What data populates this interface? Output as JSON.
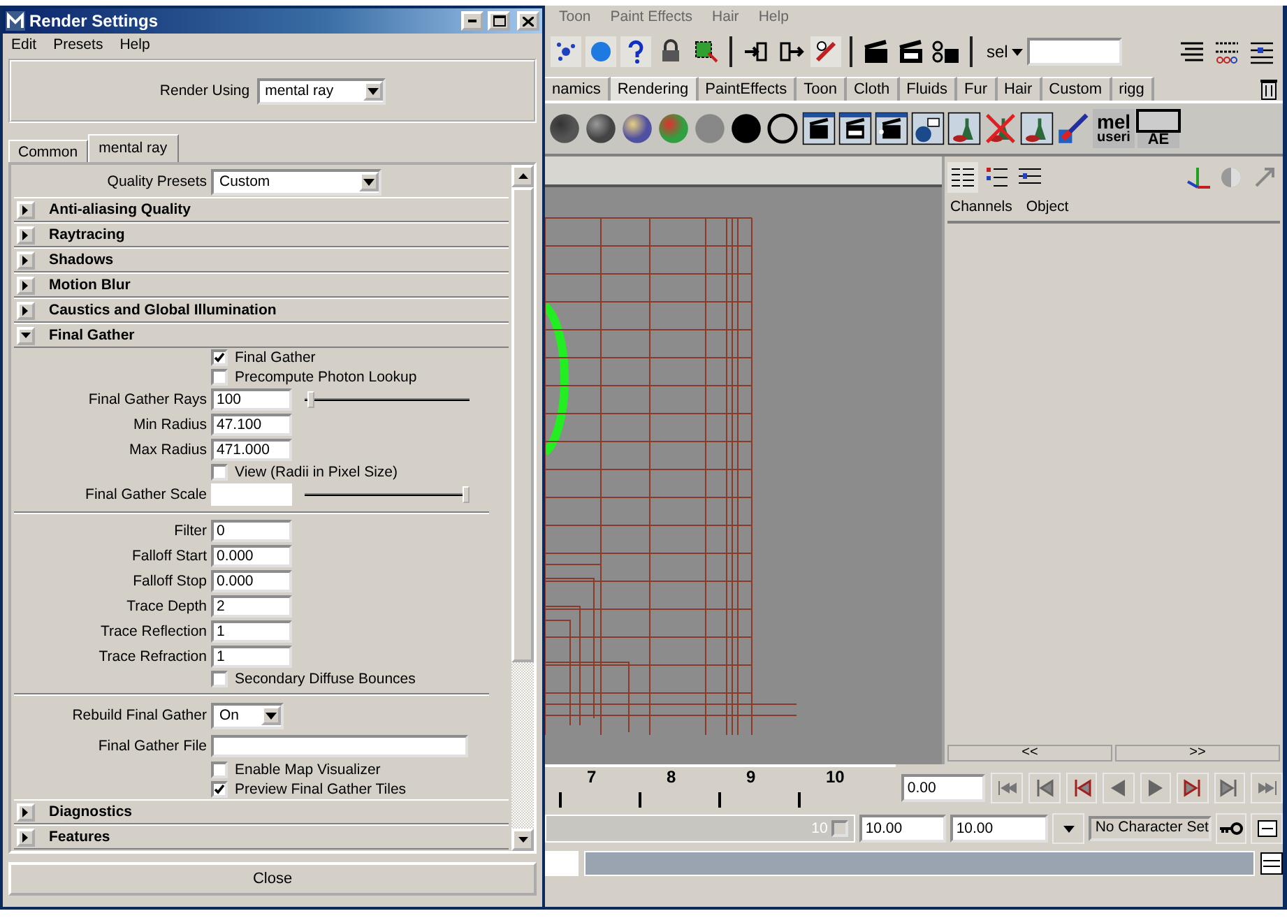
{
  "dialog": {
    "title": "Render Settings",
    "menu": [
      "Edit",
      "Presets",
      "Help"
    ],
    "render_using": {
      "label": "Render Using",
      "value": "mental ray"
    },
    "tabs": [
      {
        "label": "Common",
        "selected": false
      },
      {
        "label": "mental ray",
        "selected": true
      }
    ],
    "quality_presets": {
      "label": "Quality Presets",
      "value": "Custom"
    },
    "sections": [
      {
        "title": "Anti-aliasing Quality",
        "expanded": false
      },
      {
        "title": "Raytracing",
        "expanded": false
      },
      {
        "title": "Shadows",
        "expanded": false
      },
      {
        "title": "Motion Blur",
        "expanded": false
      },
      {
        "title": "Caustics and Global Illumination",
        "expanded": false
      },
      {
        "title": "Final Gather",
        "expanded": true,
        "rows": [
          {
            "kind": "checkbox",
            "label": "Final Gather",
            "checked": true
          },
          {
            "kind": "checkbox",
            "label": "Precompute Photon Lookup",
            "checked": false
          },
          {
            "kind": "field",
            "label": "Final Gather Rays",
            "value": "100",
            "level": 0.02
          },
          {
            "kind": "field",
            "label": "Min Radius",
            "value": "47.100"
          },
          {
            "kind": "field",
            "label": "Max Radius",
            "value": "471.000"
          },
          {
            "kind": "checkbox",
            "label": "View (Radii in Pixel Size)",
            "checked": false
          },
          {
            "kind": "field",
            "label": "Final Gather Scale",
            "level": 1
          },
          {
            "kind": "divider"
          },
          {
            "kind": "field",
            "label": "Filter",
            "value": "0"
          },
          {
            "kind": "field",
            "label": "Falloff Start",
            "value": "0.000"
          },
          {
            "kind": "field",
            "label": "Falloff Stop",
            "value": "0.000"
          },
          {
            "kind": "field",
            "label": "Trace Depth",
            "value": "2"
          },
          {
            "kind": "field",
            "label": "Trace Reflection",
            "value": "1"
          },
          {
            "kind": "field",
            "label": "Trace Refraction",
            "value": "1"
          },
          {
            "kind": "checkbox",
            "label": "Secondary Diffuse Bounces",
            "checked": false
          },
          {
            "kind": "divider"
          },
          {
            "kind": "dropdown",
            "label": "Rebuild Final Gather",
            "value": "On"
          },
          {
            "kind": "file",
            "label": "Final Gather File"
          },
          {
            "kind": "checkbox",
            "label": "Enable Map Visualizer",
            "checked": false
          },
          {
            "kind": "checkbox",
            "label": "Preview Final Gather Tiles",
            "checked": true
          }
        ]
      },
      {
        "title": "Diagnostics",
        "expanded": false
      },
      {
        "title": "Features",
        "expanded": false
      }
    ],
    "close_button": "Close"
  },
  "main": {
    "menu": [
      "Toon",
      "Paint Effects",
      "Hair",
      "Help"
    ],
    "selection_label": "sel",
    "shelf_tabs": [
      {
        "label": "namics",
        "selected": false
      },
      {
        "label": "Rendering",
        "selected": true
      },
      {
        "label": "PaintEffects",
        "selected": false
      },
      {
        "label": "Toon",
        "selected": false
      },
      {
        "label": "Cloth",
        "selected": false
      },
      {
        "label": "Fluids",
        "selected": false
      },
      {
        "label": "Fur",
        "selected": false
      },
      {
        "label": "Hair",
        "selected": false
      },
      {
        "label": "Custom",
        "selected": false
      },
      {
        "label": "rigg",
        "selected": false
      }
    ],
    "shelf_labels": {
      "mel": "mel",
      "user": "useri",
      "ae": "AE"
    },
    "channel_box": {
      "tabs": [
        "Channels",
        "Object"
      ],
      "scroll_left": "<<",
      "scroll_right": ">>"
    },
    "time_slider": {
      "ticks": [
        "7",
        "8",
        "9",
        "10"
      ],
      "current_time": "0.00"
    },
    "range_slider": {
      "end_label": "10",
      "level": 1,
      "start_field": "10.00",
      "end_field": "10.00",
      "character_set": "No Character Set"
    }
  }
}
